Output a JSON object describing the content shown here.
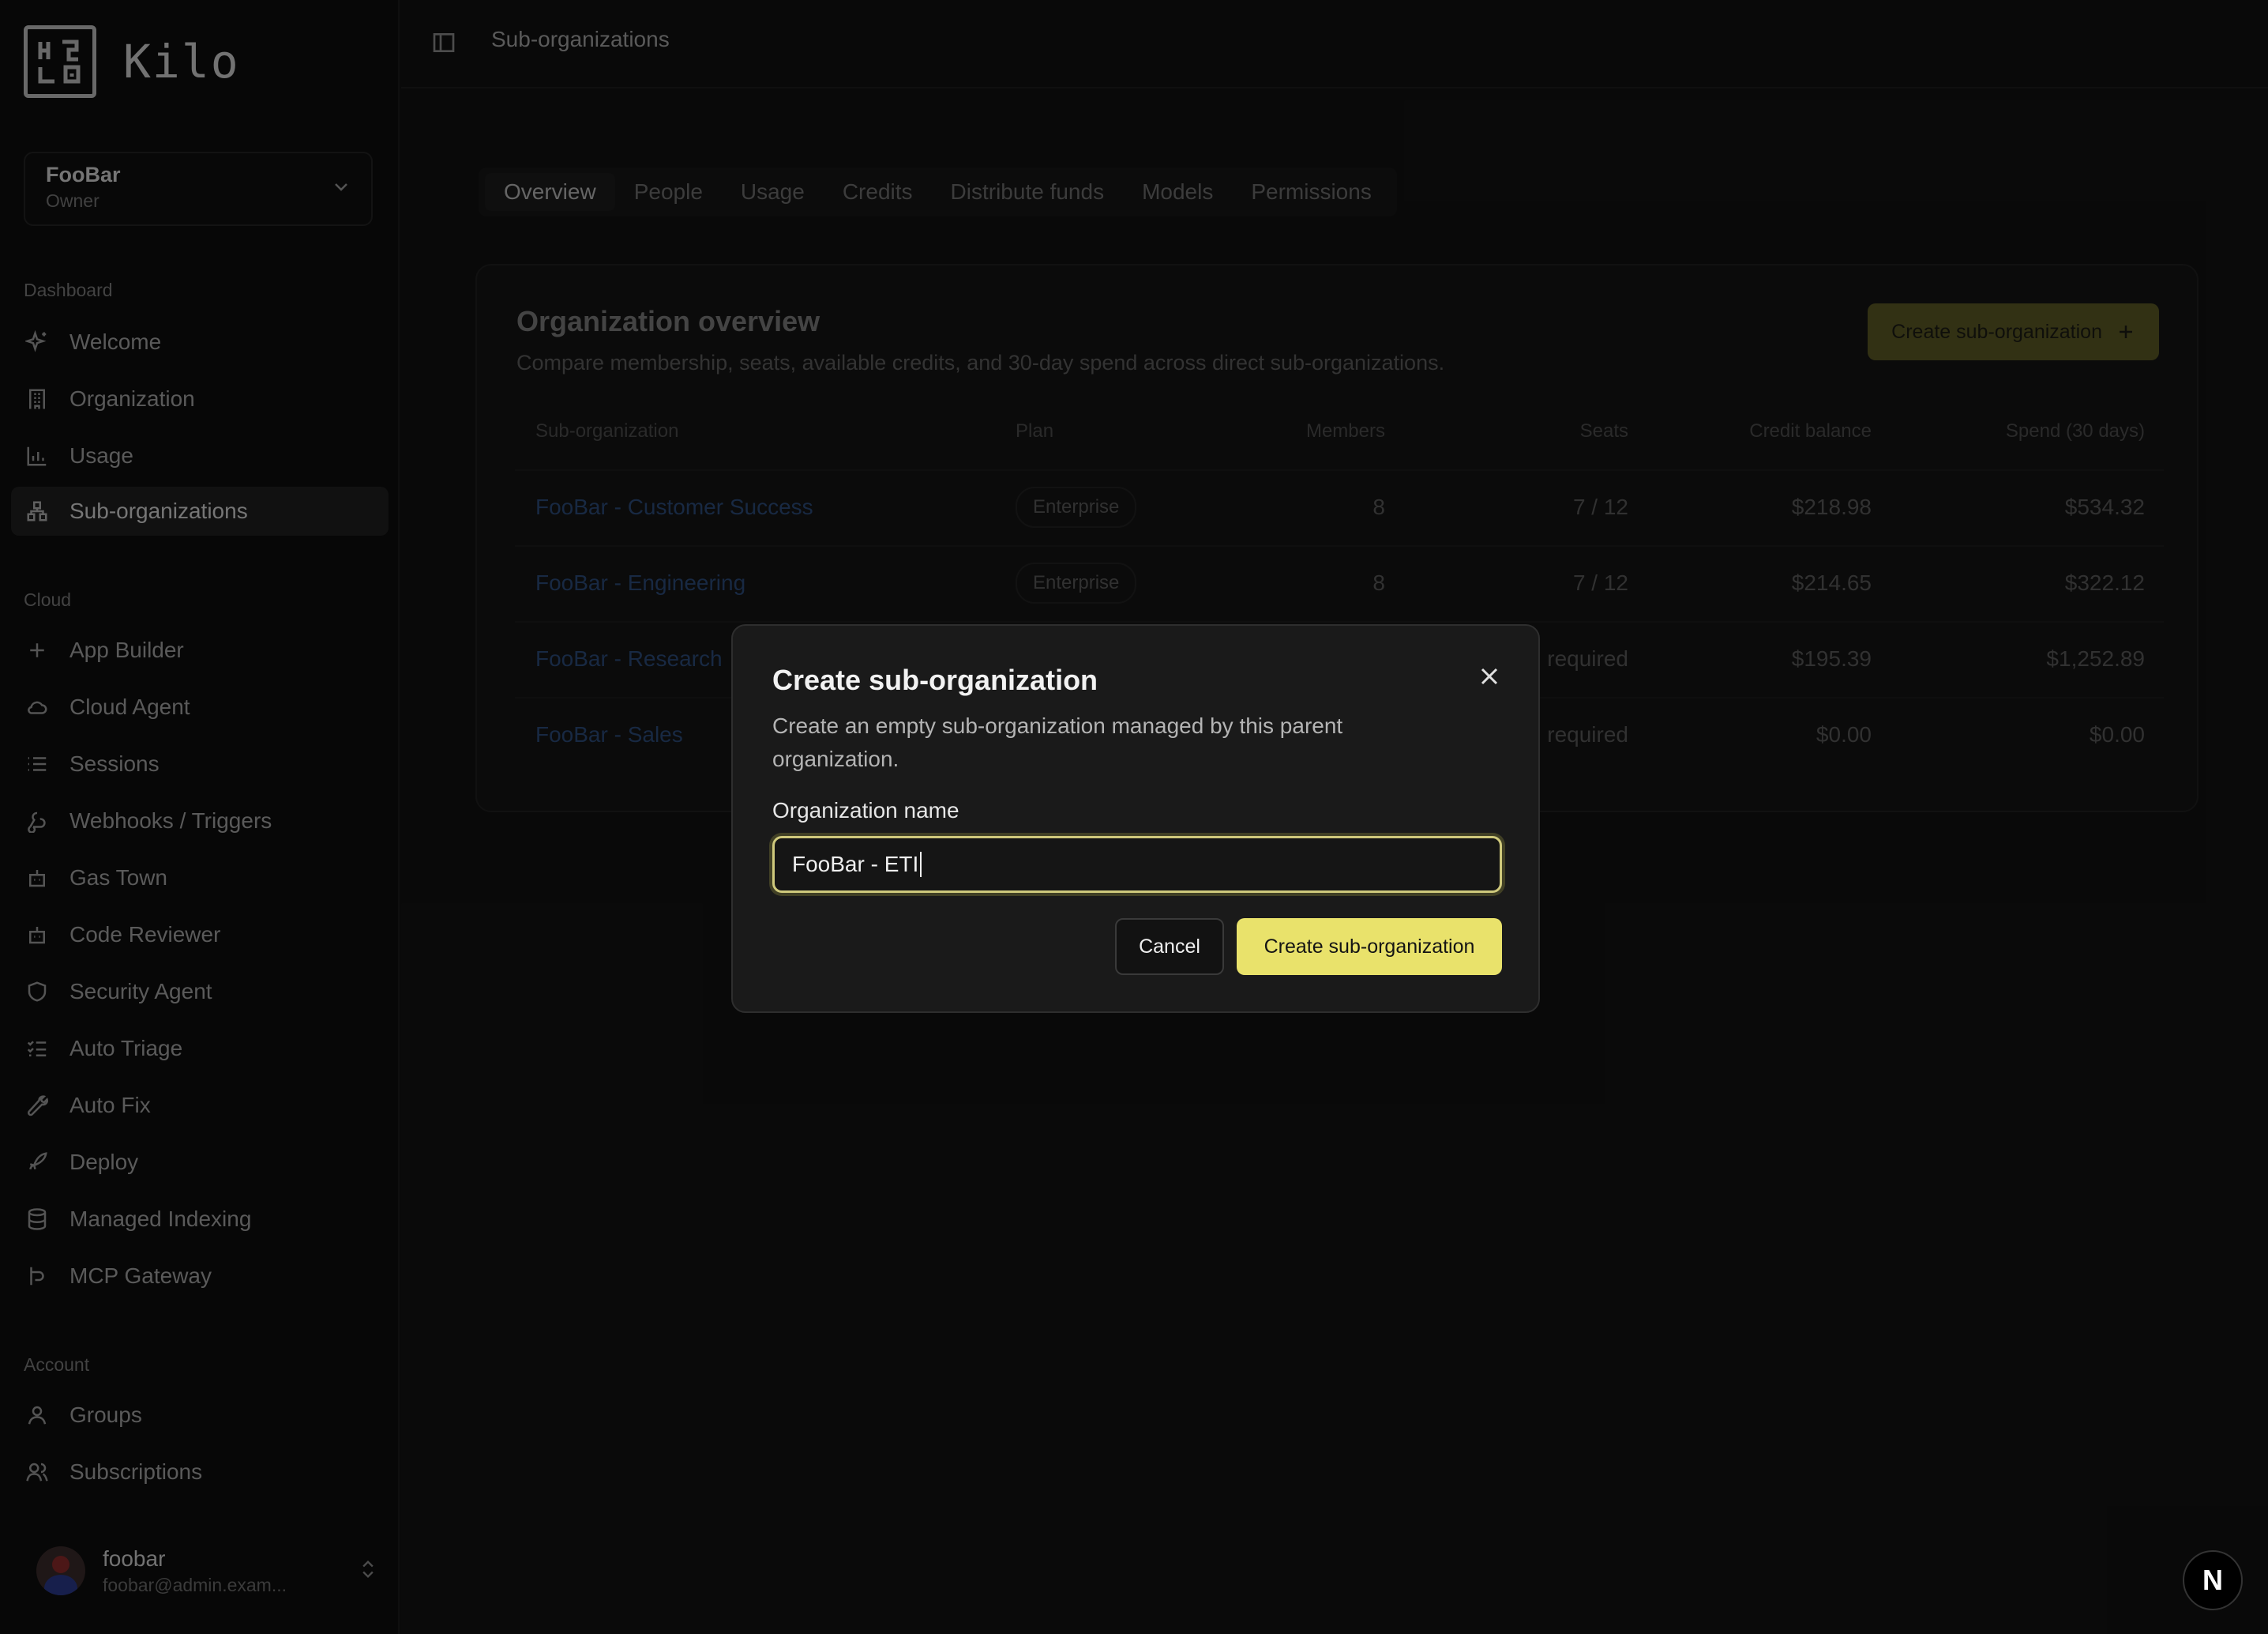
{
  "app": {
    "logo_text": "Kilo"
  },
  "org_switcher": {
    "name": "FooBar",
    "role": "Owner"
  },
  "sidebar": {
    "sections": [
      {
        "label": "Dashboard",
        "items": [
          {
            "label": "Welcome",
            "icon": "sparkles-icon"
          },
          {
            "label": "Organization",
            "icon": "building-icon"
          },
          {
            "label": "Usage",
            "icon": "bar-chart-icon"
          },
          {
            "label": "Sub-organizations",
            "icon": "network-icon",
            "active": true
          }
        ]
      },
      {
        "label": "Cloud",
        "items": [
          {
            "label": "App Builder",
            "icon": "plus-icon"
          },
          {
            "label": "Cloud Agent",
            "icon": "cloud-icon"
          },
          {
            "label": "Sessions",
            "icon": "list-icon"
          },
          {
            "label": "Webhooks / Triggers",
            "icon": "webhook-icon"
          },
          {
            "label": "Gas Town",
            "icon": "bot-icon"
          },
          {
            "label": "Code Reviewer",
            "icon": "bot-icon"
          },
          {
            "label": "Security Agent",
            "icon": "shield-icon"
          },
          {
            "label": "Auto Triage",
            "icon": "list-checks-icon"
          },
          {
            "label": "Auto Fix",
            "icon": "wrench-icon"
          },
          {
            "label": "Deploy",
            "icon": "rocket-icon"
          },
          {
            "label": "Managed Indexing",
            "icon": "database-icon"
          },
          {
            "label": "MCP Gateway",
            "icon": "route-icon"
          }
        ]
      },
      {
        "label": "Account",
        "items": [
          {
            "label": "Groups",
            "icon": "user-icon"
          },
          {
            "label": "Subscriptions",
            "icon": "users-icon"
          }
        ]
      }
    ]
  },
  "user": {
    "name": "foobar",
    "email": "foobar@admin.exam..."
  },
  "topbar": {
    "breadcrumb": "Sub-organizations"
  },
  "tabs": [
    "Overview",
    "People",
    "Usage",
    "Credits",
    "Distribute funds",
    "Models",
    "Permissions"
  ],
  "overview": {
    "title": "Organization overview",
    "description": "Compare membership, seats, available credits, and 30-day spend across direct sub-organizations.",
    "create_button": "Create sub-organization",
    "columns": [
      "Sub-organization",
      "Plan",
      "Members",
      "Seats",
      "Credit balance",
      "Spend (30 days)"
    ],
    "rows": [
      {
        "name": "FooBar - Customer Success",
        "plan": "Enterprise",
        "members": "8",
        "seats": "7 / 12",
        "credit": "$218.98",
        "spend": "$534.32"
      },
      {
        "name": "FooBar - Engineering",
        "plan": "Enterprise",
        "members": "8",
        "seats": "7 / 12",
        "credit": "$214.65",
        "spend": "$322.12"
      },
      {
        "name": "FooBar - Research",
        "plan": "",
        "members": "",
        "seats": "required",
        "credit": "$195.39",
        "spend": "$1,252.89"
      },
      {
        "name": "FooBar - Sales",
        "plan": "",
        "members": "",
        "seats": "required",
        "credit": "$0.00",
        "spend": "$0.00"
      }
    ]
  },
  "dialog": {
    "title": "Create sub-organization",
    "description": "Create an empty sub-organization managed by this parent organization.",
    "field_label": "Organization name",
    "field_value": "FooBar - ETI",
    "cancel_label": "Cancel",
    "submit_label": "Create sub-organization"
  },
  "dev_badge": "N",
  "colors": {
    "accent": "#e9e26b",
    "link": "#2c4c7a",
    "background": "#121212"
  }
}
